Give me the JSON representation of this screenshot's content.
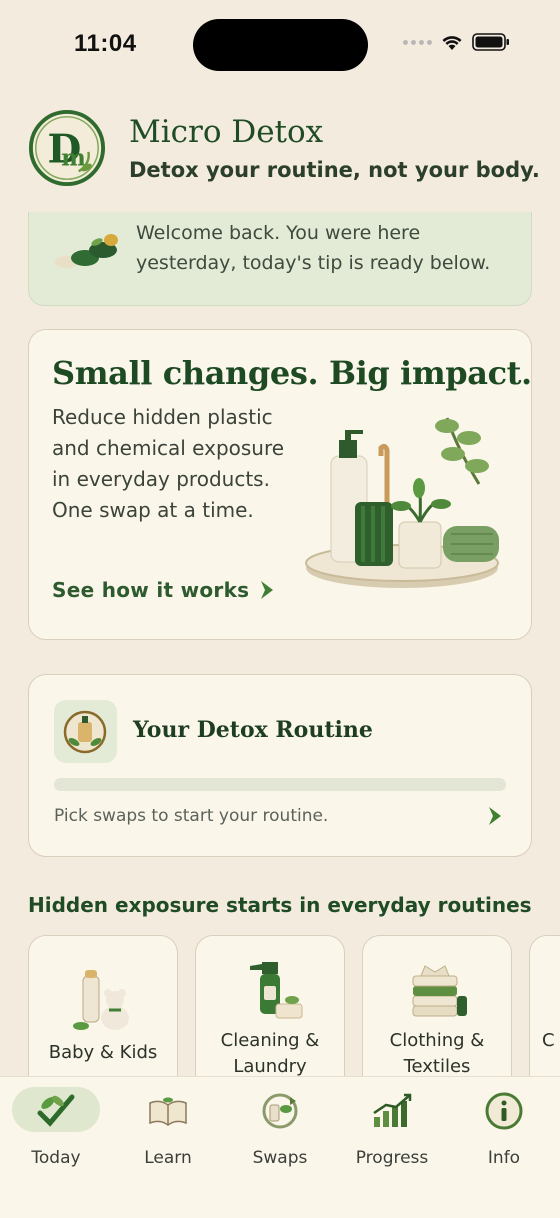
{
  "status_bar": {
    "time": "11:04",
    "icons": [
      "signal-dots-icon",
      "wifi-icon",
      "battery-icon"
    ]
  },
  "header": {
    "title": "Micro Detox",
    "tagline": "Detox your routine, not your body.",
    "logo_icon": "dm-monogram-logo"
  },
  "welcome": {
    "text": "Welcome back. You were here yesterday, today's tip is ready below.",
    "icon": "stones-icon"
  },
  "hero": {
    "title": "Small changes. Big impact.",
    "body": "Reduce hidden plastic and chemical exposure in everyday products. One swap at a time.",
    "link_label": "See how it works",
    "illustration": "bathroom-products-illustration"
  },
  "routine": {
    "title": "Your Detox Routine",
    "progress": 0,
    "hint": "Pick swaps to start your routine."
  },
  "section": {
    "title": "Hidden exposure starts in everyday routines",
    "categories": [
      {
        "label": "Baby & Kids",
        "icon": "baby-bottle-teddy-icon"
      },
      {
        "label": "Cleaning & Laundry",
        "icon": "spray-bottle-icon"
      },
      {
        "label": "Clothing & Textiles",
        "icon": "folded-clothes-icon"
      },
      {
        "label": "C",
        "icon": "category-icon"
      }
    ]
  },
  "tab_bar": {
    "active": "Today",
    "tabs": [
      {
        "label": "Today",
        "icon": "leaf-check-icon"
      },
      {
        "label": "Learn",
        "icon": "open-book-icon"
      },
      {
        "label": "Swaps",
        "icon": "swap-cycle-icon"
      },
      {
        "label": "Progress",
        "icon": "growth-chart-icon"
      },
      {
        "label": "Info",
        "icon": "info-icon"
      }
    ]
  },
  "colors": {
    "background": "#f4ebdf",
    "card": "#fbf6ea",
    "brand_green": "#1f4b25",
    "accent_green": "#5e8f40",
    "welcome_bg": "#e3ead6"
  }
}
